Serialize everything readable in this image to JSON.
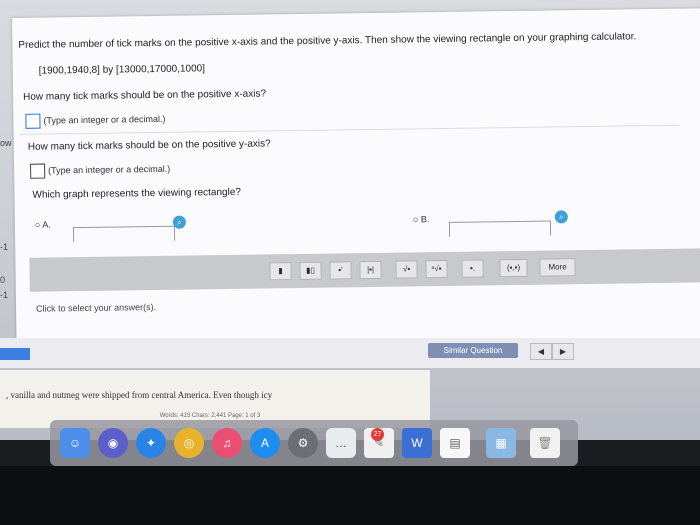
{
  "question": {
    "prompt": "Predict the number of tick marks on the positive x-axis and the positive y-axis. Then show the viewing rectangle on your graphing calculator.",
    "window": "[1900,1940,8] by [13000,17000,1000]",
    "x_question": "How many tick marks should be on the positive x-axis?",
    "x_hint": "(Type an integer or a decimal.)",
    "y_question": "How many tick marks should be on the positive y-axis?",
    "y_hint": "(Type an integer or a decimal.)",
    "graph_question": "Which graph represents the viewing rectangle?",
    "option_a": "A.",
    "option_b": "B."
  },
  "toolbar": {
    "more_label": "More",
    "click_text": "Click to select your answer(s)."
  },
  "bottom": {
    "similar_label": "Similar Question"
  },
  "background_doc": {
    "text": ", vanilla and nutmeg were shipped from central America. Even though icy",
    "status": "Words: 415   Chars: 2,441   Page: 1 of 3"
  },
  "left_strip": {
    "label_ow": "ow",
    "label_neg1": "-1",
    "label_0": "0",
    "label_neg1b": "-1"
  },
  "dock": {
    "badge": "27"
  }
}
